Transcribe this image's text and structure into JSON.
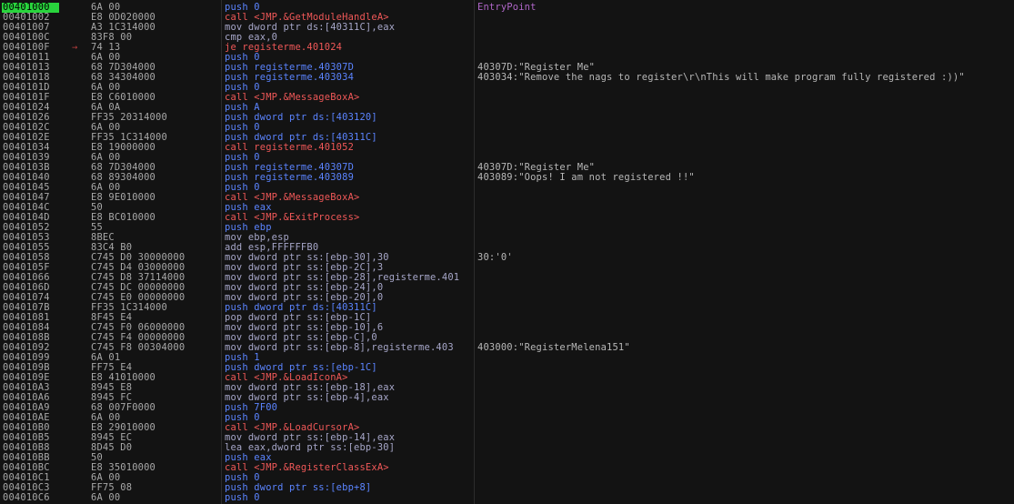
{
  "colors": {
    "background": "#131313",
    "selection": "#29d43d",
    "address": "#a8a8a8",
    "push": "#5b84ff",
    "call": "#f05858",
    "mov": "#a6a6c8",
    "entry_label": "#b066c8"
  },
  "rows": [
    {
      "addr": "00401000",
      "bytes": "6A 00",
      "instr": "push 0",
      "kind": "push",
      "comment": "EntryPoint",
      "selected": true
    },
    {
      "addr": "00401002",
      "bytes": "E8 0D020000",
      "instr": "call <JMP.&GetModuleHandleA>",
      "kind": "call",
      "comment": ""
    },
    {
      "addr": "00401007",
      "bytes": "A3 1C314000",
      "instr": "mov dword ptr ds:[40311C],eax",
      "kind": "mov",
      "comment": ""
    },
    {
      "addr": "0040100C",
      "bytes": "83F8 00",
      "instr": "cmp eax,0",
      "kind": "cmp",
      "comment": ""
    },
    {
      "addr": "0040100F",
      "bytes": "74 13",
      "instr": "je registerme.401024",
      "kind": "je",
      "comment": "",
      "arrow": true
    },
    {
      "addr": "00401011",
      "bytes": "6A 00",
      "instr": "push 0",
      "kind": "push",
      "comment": ""
    },
    {
      "addr": "00401013",
      "bytes": "68 7D304000",
      "instr": "push registerme.40307D",
      "kind": "push",
      "comment": "40307D:\"Register Me\""
    },
    {
      "addr": "00401018",
      "bytes": "68 34304000",
      "instr": "push registerme.403034",
      "kind": "push",
      "comment": "403034:\"Remove the nags to register\\r\\nThis will make program fully registered :))\""
    },
    {
      "addr": "0040101D",
      "bytes": "6A 00",
      "instr": "push 0",
      "kind": "push",
      "comment": ""
    },
    {
      "addr": "0040101F",
      "bytes": "E8 C6010000",
      "instr": "call <JMP.&MessageBoxA>",
      "kind": "call",
      "comment": ""
    },
    {
      "addr": "00401024",
      "bytes": "6A 0A",
      "instr": "push A",
      "kind": "push",
      "comment": ""
    },
    {
      "addr": "00401026",
      "bytes": "FF35 20314000",
      "instr": "push dword ptr ds:[403120]",
      "kind": "push",
      "comment": ""
    },
    {
      "addr": "0040102C",
      "bytes": "6A 00",
      "instr": "push 0",
      "kind": "push",
      "comment": ""
    },
    {
      "addr": "0040102E",
      "bytes": "FF35 1C314000",
      "instr": "push dword ptr ds:[40311C]",
      "kind": "push",
      "comment": ""
    },
    {
      "addr": "00401034",
      "bytes": "E8 19000000",
      "instr": "call registerme.401052",
      "kind": "call",
      "comment": ""
    },
    {
      "addr": "00401039",
      "bytes": "6A 00",
      "instr": "push 0",
      "kind": "push",
      "comment": ""
    },
    {
      "addr": "0040103B",
      "bytes": "68 7D304000",
      "instr": "push registerme.40307D",
      "kind": "push",
      "comment": "40307D:\"Register Me\""
    },
    {
      "addr": "00401040",
      "bytes": "68 89304000",
      "instr": "push registerme.403089",
      "kind": "push",
      "comment": "403089:\"Oops! I am not registered !!\""
    },
    {
      "addr": "00401045",
      "bytes": "6A 00",
      "instr": "push 0",
      "kind": "push",
      "comment": ""
    },
    {
      "addr": "00401047",
      "bytes": "E8 9E010000",
      "instr": "call <JMP.&MessageBoxA>",
      "kind": "call",
      "comment": ""
    },
    {
      "addr": "0040104C",
      "bytes": "50",
      "instr": "push eax",
      "kind": "push",
      "comment": ""
    },
    {
      "addr": "0040104D",
      "bytes": "E8 BC010000",
      "instr": "call <JMP.&ExitProcess>",
      "kind": "call",
      "comment": ""
    },
    {
      "addr": "00401052",
      "bytes": "55",
      "instr": "push ebp",
      "kind": "push",
      "comment": ""
    },
    {
      "addr": "00401053",
      "bytes": "8BEC",
      "instr": "mov ebp,esp",
      "kind": "mov",
      "comment": ""
    },
    {
      "addr": "00401055",
      "bytes": "83C4 B0",
      "instr": "add esp,FFFFFFB0",
      "kind": "add",
      "comment": ""
    },
    {
      "addr": "00401058",
      "bytes": "C745 D0 30000000",
      "instr": "mov dword ptr ss:[ebp-30],30",
      "kind": "mov",
      "comment": "30:'0'"
    },
    {
      "addr": "0040105F",
      "bytes": "C745 D4 03000000",
      "instr": "mov dword ptr ss:[ebp-2C],3",
      "kind": "mov",
      "comment": ""
    },
    {
      "addr": "00401066",
      "bytes": "C745 D8 37114000",
      "instr": "mov dword ptr ss:[ebp-28],registerme.401",
      "kind": "mov",
      "comment": ""
    },
    {
      "addr": "0040106D",
      "bytes": "C745 DC 00000000",
      "instr": "mov dword ptr ss:[ebp-24],0",
      "kind": "mov",
      "comment": ""
    },
    {
      "addr": "00401074",
      "bytes": "C745 E0 00000000",
      "instr": "mov dword ptr ss:[ebp-20],0",
      "kind": "mov",
      "comment": ""
    },
    {
      "addr": "0040107B",
      "bytes": "FF35 1C314000",
      "instr": "push dword ptr ds:[40311C]",
      "kind": "push",
      "comment": ""
    },
    {
      "addr": "00401081",
      "bytes": "8F45 E4",
      "instr": "pop dword ptr ss:[ebp-1C]",
      "kind": "pop",
      "comment": ""
    },
    {
      "addr": "00401084",
      "bytes": "C745 F0 06000000",
      "instr": "mov dword ptr ss:[ebp-10],6",
      "kind": "mov",
      "comment": ""
    },
    {
      "addr": "0040108B",
      "bytes": "C745 F4 00000000",
      "instr": "mov dword ptr ss:[ebp-C],0",
      "kind": "mov",
      "comment": ""
    },
    {
      "addr": "00401092",
      "bytes": "C745 F8 00304000",
      "instr": "mov dword ptr ss:[ebp-8],registerme.403",
      "kind": "mov",
      "comment": "403000:\"RegisterMelena151\""
    },
    {
      "addr": "00401099",
      "bytes": "6A 01",
      "instr": "push 1",
      "kind": "push",
      "comment": ""
    },
    {
      "addr": "0040109B",
      "bytes": "FF75 E4",
      "instr": "push dword ptr ss:[ebp-1C]",
      "kind": "push",
      "comment": ""
    },
    {
      "addr": "0040109E",
      "bytes": "E8 41010000",
      "instr": "call <JMP.&LoadIconA>",
      "kind": "call",
      "comment": ""
    },
    {
      "addr": "004010A3",
      "bytes": "8945 E8",
      "instr": "mov dword ptr ss:[ebp-18],eax",
      "kind": "mov",
      "comment": ""
    },
    {
      "addr": "004010A6",
      "bytes": "8945 FC",
      "instr": "mov dword ptr ss:[ebp-4],eax",
      "kind": "mov",
      "comment": ""
    },
    {
      "addr": "004010A9",
      "bytes": "68 007F0000",
      "instr": "push 7F00",
      "kind": "push",
      "comment": ""
    },
    {
      "addr": "004010AE",
      "bytes": "6A 00",
      "instr": "push 0",
      "kind": "push",
      "comment": ""
    },
    {
      "addr": "004010B0",
      "bytes": "E8 29010000",
      "instr": "call <JMP.&LoadCursorA>",
      "kind": "call",
      "comment": ""
    },
    {
      "addr": "004010B5",
      "bytes": "8945 EC",
      "instr": "mov dword ptr ss:[ebp-14],eax",
      "kind": "mov",
      "comment": ""
    },
    {
      "addr": "004010B8",
      "bytes": "8D45 D0",
      "instr": "lea eax,dword ptr ss:[ebp-30]",
      "kind": "lea",
      "comment": ""
    },
    {
      "addr": "004010BB",
      "bytes": "50",
      "instr": "push eax",
      "kind": "push",
      "comment": ""
    },
    {
      "addr": "004010BC",
      "bytes": "E8 35010000",
      "instr": "call <JMP.&RegisterClassExA>",
      "kind": "call",
      "comment": ""
    },
    {
      "addr": "004010C1",
      "bytes": "6A 00",
      "instr": "push 0",
      "kind": "push",
      "comment": ""
    },
    {
      "addr": "004010C3",
      "bytes": "FF75 08",
      "instr": "push dword ptr ss:[ebp+8]",
      "kind": "push",
      "comment": ""
    },
    {
      "addr": "004010C6",
      "bytes": "6A 00",
      "instr": "push 0",
      "kind": "push",
      "comment": ""
    }
  ]
}
